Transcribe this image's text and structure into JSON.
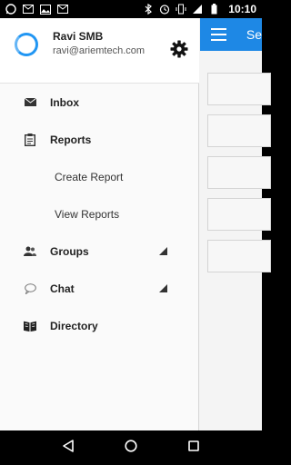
{
  "status_bar": {
    "time": "10:10",
    "left_icons": [
      "whatsapp-icon",
      "gmail-icon",
      "image-icon",
      "gmail-icon"
    ],
    "right_icons": [
      "bluetooth-icon",
      "alarm-icon",
      "vibrate-icon",
      "signal-icon",
      "battery-icon"
    ]
  },
  "drawer": {
    "user_name": "Ravi SMB",
    "user_email": "ravi@ariemtech.com",
    "items": [
      {
        "label": "Inbox",
        "icon": "envelope-icon"
      },
      {
        "label": "Reports",
        "icon": "clipboard-icon"
      },
      {
        "label": "Create Report"
      },
      {
        "label": "View Reports"
      },
      {
        "label": "Groups",
        "icon": "people-icon"
      },
      {
        "label": "Chat",
        "icon": "chat-bubble-icon"
      },
      {
        "label": "Directory",
        "icon": "book-icon"
      }
    ]
  },
  "app": {
    "title": "Se"
  },
  "colors": {
    "accent": "#1e88e5",
    "avatar_ring": "#2196f3"
  }
}
